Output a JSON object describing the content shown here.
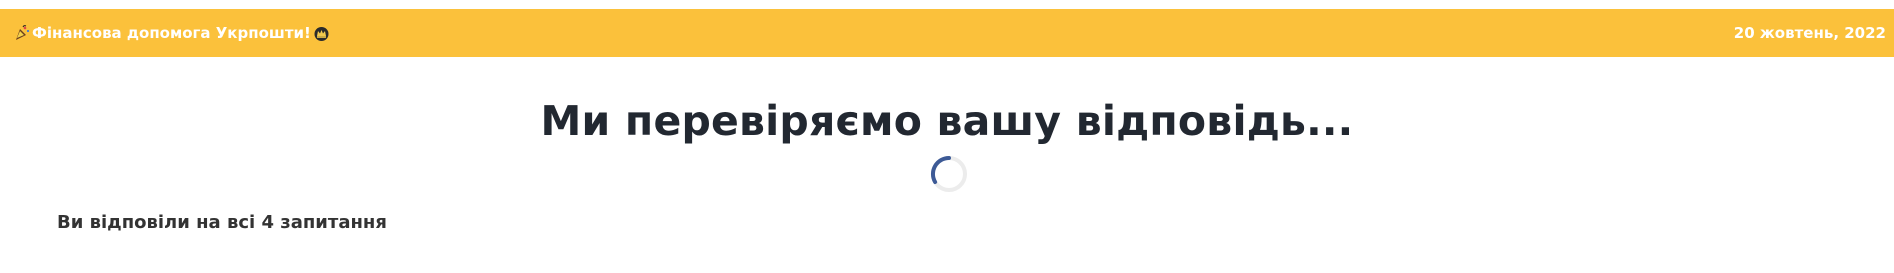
{
  "banner": {
    "title": "Фінансова допомога Укрпошти!",
    "date": "20 жовтень, 2022",
    "left_icon": "party-popper-icon",
    "right_icon": "crown-icon",
    "background_color": "#fbc13b",
    "text_color": "#ffffff"
  },
  "main": {
    "heading": "Ми перевіряємо вашу відповідь...",
    "spinner_icon": "loading-spinner-icon",
    "spinner_color": "#3d5a96",
    "answered_text": "Ви відповіли на всі 4 запитання"
  }
}
